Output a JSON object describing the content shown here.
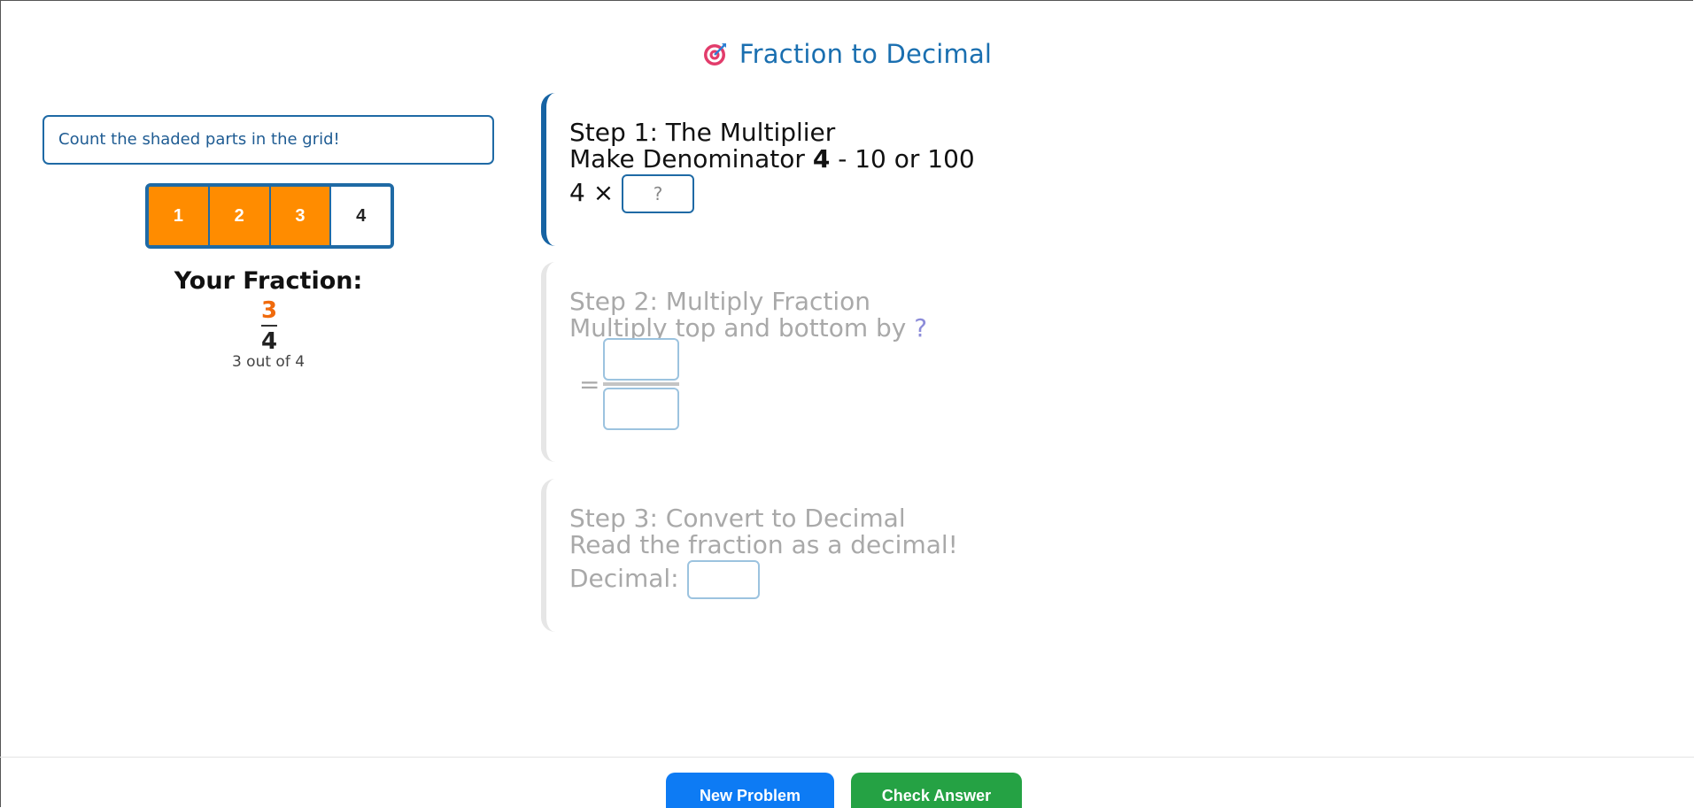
{
  "app": {
    "title": "Fraction to Decimal",
    "title_icon": "target-icon",
    "colors": {
      "accent": "#1a6fb0",
      "shaded": "#ff8c00",
      "new_button": "#0d7bf4",
      "check_button": "#25a244"
    }
  },
  "left": {
    "hint": "Count the shaded parts in the grid!",
    "grid": {
      "cells": [
        "1",
        "2",
        "3",
        "4"
      ],
      "shaded_count": 3
    },
    "fraction_label": "Your Fraction:",
    "numerator": "3",
    "denominator": "4",
    "caption": "3 out of 4"
  },
  "step1": {
    "heading": "Step 1: The Multiplier",
    "instruction_prefix": "Make Denominator ",
    "instruction_bold": "4",
    "instruction_suffix": " - 10 or 100",
    "equation_prefix": "4 ×",
    "input_placeholder": "?"
  },
  "step2": {
    "heading": "Step 2: Multiply Fraction",
    "instruction_prefix": "Multiply top and bottom by ",
    "instruction_value": "?",
    "equals": "="
  },
  "step3": {
    "heading": "Step 3: Convert to Decimal",
    "instruction": "Read the fraction as a decimal!",
    "decimal_label": "Decimal:"
  },
  "footer": {
    "new_label": "New Problem",
    "check_label": "Check Answer"
  }
}
